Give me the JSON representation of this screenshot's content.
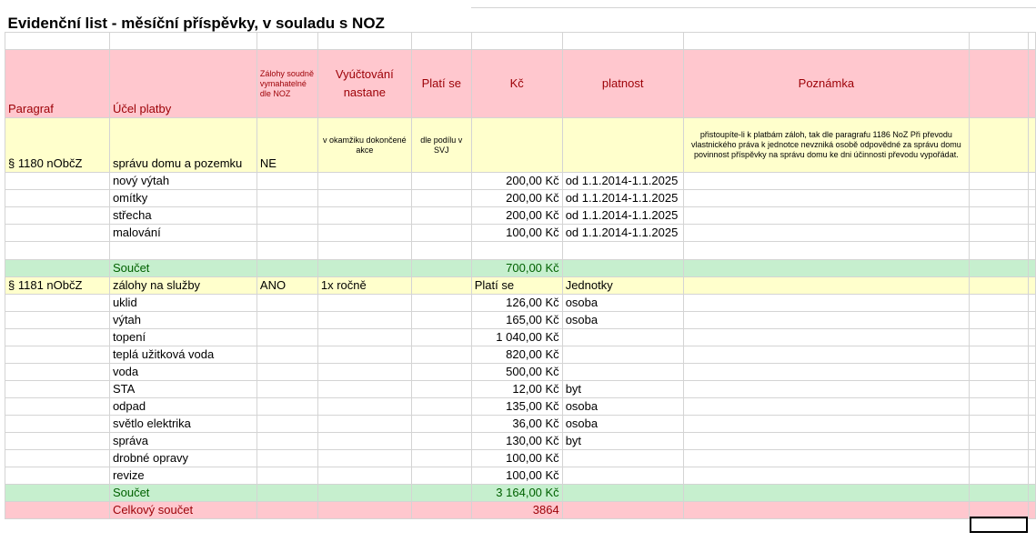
{
  "title": "Evidenční list - měsíční příspěvky, v souladu s NOZ",
  "header": {
    "paragraf": "Paragraf",
    "ucel": "Účel platby",
    "zalohy": "Zálohy soudně vymahatelné dle NOZ",
    "vyuctovani": "Vyúčtování nastane",
    "plati": "Platí se",
    "kc": "Kč",
    "platnost": "platnost",
    "poznamka": "Poznámka"
  },
  "section1": {
    "paragraf": "§ 1180 nObčZ",
    "ucel": "správu domu a pozemku",
    "zalohy": "NE",
    "vyuctovani": "v okamžiku dokončené akce",
    "plati": "dle podílu v SVJ",
    "poznamka": "přistoupíte-li k platbám záloh, tak dle paragrafu 1186 NoZ Při převodu vlastnického práva k jednotce nevzniká osobě odpovědné za správu domu povinnost příspěvky na správu domu ke dni účinnosti převodu vypořádat.",
    "items": [
      {
        "ucel": "nový výtah",
        "kc": "200,00 Kč",
        "platnost": "od 1.1.2014-1.1.2025"
      },
      {
        "ucel": "omítky",
        "kc": "200,00 Kč",
        "platnost": "od 1.1.2014-1.1.2025"
      },
      {
        "ucel": "střecha",
        "kc": "200,00 Kč",
        "platnost": "od 1.1.2014-1.1.2025"
      },
      {
        "ucel": "malování",
        "kc": "100,00 Kč",
        "platnost": "od 1.1.2014-1.1.2025"
      }
    ],
    "sum_label": "Součet",
    "sum_value": "700,00 Kč"
  },
  "section2": {
    "paragraf": "§ 1181 nObčZ",
    "ucel": "zálohy na služby",
    "zalohy": "ANO",
    "vyuctovani": "1x ročně",
    "kc": "Platí se",
    "platnost": "Jednotky",
    "items": [
      {
        "ucel": "uklid",
        "kc": "126,00 Kč",
        "platnost": "osoba"
      },
      {
        "ucel": "výtah",
        "kc": "165,00 Kč",
        "platnost": "osoba"
      },
      {
        "ucel": "topení",
        "kc": "1 040,00 Kč",
        "platnost": ""
      },
      {
        "ucel": "teplá užitková voda",
        "kc": "820,00 Kč",
        "platnost": ""
      },
      {
        "ucel": "voda",
        "kc": "500,00 Kč",
        "platnost": ""
      },
      {
        "ucel": "STA",
        "kc": "12,00 Kč",
        "platnost": "byt"
      },
      {
        "ucel": "odpad",
        "kc": "135,00 Kč",
        "platnost": "osoba"
      },
      {
        "ucel": "světlo elektrika",
        "kc": "36,00 Kč",
        "platnost": "osoba"
      },
      {
        "ucel": "správa",
        "kc": "130,00 Kč",
        "platnost": "byt"
      },
      {
        "ucel": "drobné opravy",
        "kc": "100,00 Kč",
        "platnost": ""
      },
      {
        "ucel": "revize",
        "kc": "100,00 Kč",
        "platnost": ""
      }
    ],
    "sum_label": "Součet",
    "sum_value": "3 164,00 Kč"
  },
  "total": {
    "label": "Celkový součet",
    "value": "3864"
  },
  "colors": {
    "pink": "#ffc7ce",
    "yellow": "#ffffcc",
    "green": "#c6efce",
    "green_text": "#006100",
    "red_text": "#9c0006"
  }
}
